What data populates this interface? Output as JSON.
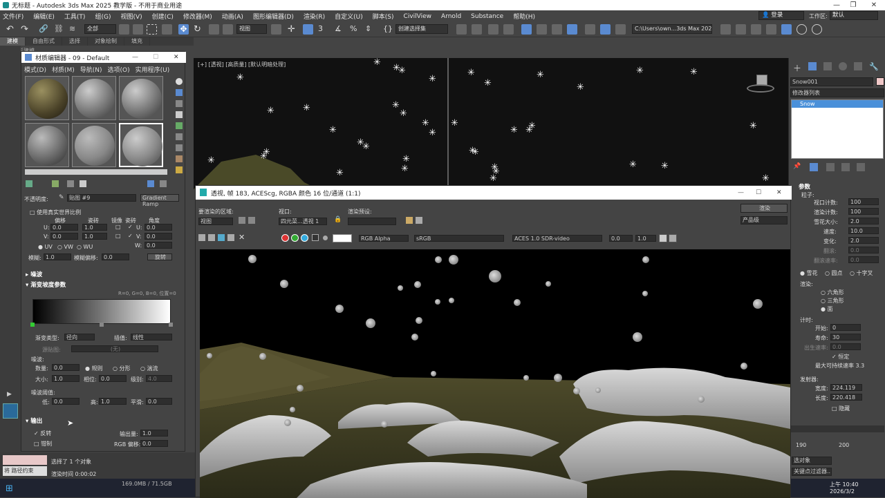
{
  "window": {
    "title": "无标题 - Autodesk 3ds Max 2025  教学版 - 不用于商业用途"
  },
  "menu": [
    "文件(F)",
    "编辑(E)",
    "工具(T)",
    "组(G)",
    "视图(V)",
    "创建(C)",
    "修改器(M)",
    "动画(A)",
    "图形编辑器(D)",
    "渲染(R)",
    "自定义(U)",
    "脚本(S)",
    "CivilView",
    "Arnold",
    "Substance",
    "帮助(H)"
  ],
  "login": {
    "label": "登录",
    "workspace_label": "工作区:",
    "workspace_value": "默认"
  },
  "toolbar": {
    "filter": "全部",
    "view": "视图",
    "selection_set": "创建选择集",
    "path": "C:\\Users\\own...3ds Max 2025"
  },
  "ribbon": [
    "建模",
    "自由形式",
    "选择",
    "对象绘制",
    "填充"
  ],
  "left_hint": "多边形建模",
  "viewport": {
    "label": "[+] [透视] [高质量] [默认明暗处理]"
  },
  "mated": {
    "title": "材质编辑器 - 09 - Default",
    "menus": [
      "模式(D)",
      "材质(M)",
      "导航(N)",
      "选项(O)",
      "实用程序(U)"
    ],
    "opacity_label": "不透明度:",
    "map_name": "贴图 #9",
    "map_type": "Gradient Ramp",
    "real_world": "使用真实世界比例",
    "col_offset": "偏移",
    "col_tiling": "瓷砖",
    "col_mirror": "镜像",
    "col_tile": "瓷砖",
    "col_angle": "角度",
    "u_offset": "0.0",
    "u_tiling": "1.0",
    "v_offset": "0.0",
    "v_tiling": "1.0",
    "u_angle": "0.0",
    "v_angle": "0.0",
    "w_angle": "0.0",
    "uv": "UV",
    "vw": "VW",
    "wu": "WU",
    "blur_label": "模糊:",
    "blur": "1.0",
    "blur_offset_label": "模糊偏移:",
    "blur_offset": "0.0",
    "rotate": "旋转",
    "noise_section": "噪波",
    "ramp_section": "渐变坡度参数",
    "ramp_pos": "R=0, G=0, B=0,  位置=0",
    "grad_type_label": "渐变类型:",
    "grad_type": "径向",
    "interp_label": "插值:",
    "interp": "线性",
    "source_map_label": "源贴图:",
    "source_map": "(无)",
    "noise_label": "噪波:",
    "amount_label": "数量:",
    "amount": "0.0",
    "regular": "规则",
    "fractal": "分形",
    "turbulence": "湍流",
    "size_label": "大小:",
    "size": "1.0",
    "phase_label": "相位:",
    "phase": "0.0",
    "levels_label": "级别:",
    "levels": "4.0",
    "threshold_label": "噪波阈值:",
    "low_label": "低:",
    "low": "0.0",
    "high_label": "高:",
    "high": "1.0",
    "smooth_label": "平滑:",
    "smooth": "0.0",
    "output_section": "输出",
    "invert": "反转",
    "output_amount_label": "输出量:",
    "output_amount": "1.0",
    "clamp": "钳制",
    "rgb_offset_label": "RGB 偏移:",
    "rgb_offset": "0.0"
  },
  "render": {
    "title": "透视, 帧 183, ACEScg, RGBA 颜色 16 位/通道 (1:1)",
    "area_label": "要渲染的区域:",
    "area_value": "视图",
    "viewport_label": "视口:",
    "viewport_value": "四元菜...透视 1",
    "preset_label": "渲染预设:",
    "preset_value": "",
    "render_btn": "渲染",
    "quality": "产品级",
    "channel": "RGB Alpha",
    "colorspace": "sRGB",
    "display": "ACES 1.0 SDR-video",
    "exposure": "0.0",
    "gamma": "1.0"
  },
  "cmd": {
    "object_name": "Snow001",
    "modifier_list": "修改器列表",
    "stack_item": "Snow",
    "params_section": "参数",
    "particles_label": "粒子:",
    "vp_count_label": "视口计数:",
    "vp_count": "100",
    "render_count_label": "渲染计数:",
    "render_count": "100",
    "flake_size_label": "雪花大小:",
    "flake_size": "2.0",
    "speed_label": "速度:",
    "speed": "10.0",
    "variation_label": "变化:",
    "variation": "2.0",
    "tumble_label": "翻滚:",
    "tumble": "0.0",
    "tumble_rate_label": "翻滚速率:",
    "tumble_rate": "0.0",
    "flakes": "雪花",
    "dots": "圆点",
    "ticks": "十字叉",
    "render_label": "渲染:",
    "six_point": "六角形",
    "triangle": "三角形",
    "facing": "面",
    "timing_label": "计时:",
    "start_label": "开始:",
    "start": "0",
    "life_label": "寿命:",
    "life": "30",
    "birth_rate_label": "出生速率:",
    "birth_rate": "0.0",
    "constant": "恒定",
    "max_rate_label": "最大可持续速率",
    "max_rate": "3.3",
    "emitter_label": "发射器:",
    "width_label": "宽度:",
    "width": "224.119",
    "length_label": "长度:",
    "length": "220.418",
    "hide": "隐藏",
    "timeline_190": "190",
    "timeline_200": "200",
    "select_mode": "选对象",
    "key_filter": "关键点过滤器..."
  },
  "status": {
    "selected": "选择了 1 个对象",
    "render_time_label": "渲染时间",
    "render_time": "0:00:02",
    "path_constraint": "将 路径约束",
    "memory": "169.0MB / 71.5GB"
  },
  "taskbar": {
    "time": "上午 10:40",
    "date": "2026/3/2"
  },
  "colors": {
    "accent": "#4a90d9",
    "title_bg": "#ffffff",
    "panel_bg": "#444444",
    "viewport_bg": "#111111"
  }
}
